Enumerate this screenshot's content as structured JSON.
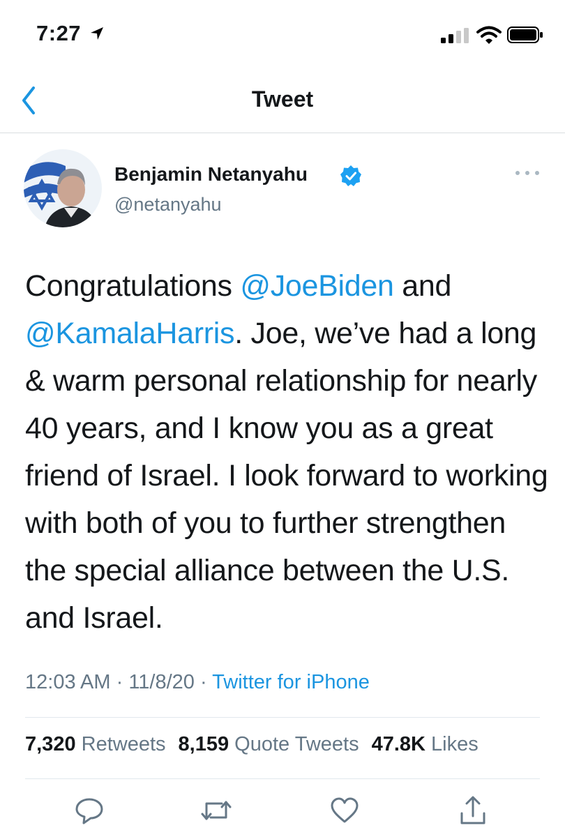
{
  "status_bar": {
    "time": "7:27"
  },
  "nav": {
    "title": "Tweet"
  },
  "tweet": {
    "author_name": "Benjamin Netanyahu",
    "handle": "@netanyahu",
    "text": {
      "t1": "Congratulations ",
      "m1": "@JoeBiden",
      "t2": " and ",
      "m2": "@KamalaHarris",
      "t3": ". Joe, we’ve had a long & warm personal relationship for nearly 40 years, and I know you as a great friend of Israel. I look forward to working with both of you to further strengthen the special alliance between the U.S. and Israel."
    },
    "time": "12:03 AM",
    "date": "11/8/20",
    "source": "Twitter for iPhone"
  },
  "stats": {
    "retweets_count": "7,320",
    "retweets_label": "Retweets",
    "quotes_count": "8,159",
    "quotes_label": "Quote Tweets",
    "likes_count": "47.8K",
    "likes_label": "Likes"
  },
  "colors": {
    "link": "#1b95e0",
    "secondary": "#657786",
    "text": "#14171a",
    "divider": "#e1e8ed"
  },
  "icons": [
    "location-arrow-icon",
    "signal-icon",
    "wifi-icon",
    "battery-icon",
    "back-chevron-icon",
    "verified-badge-icon",
    "more-options-icon",
    "reply-icon",
    "retweet-icon",
    "like-icon",
    "share-icon"
  ]
}
